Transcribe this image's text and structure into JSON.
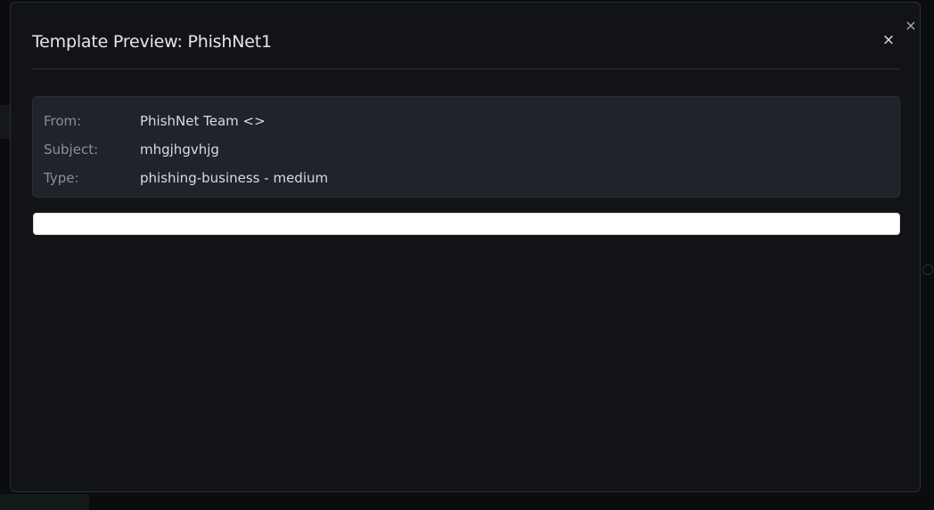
{
  "modal": {
    "title": "Template Preview: PhishNet1",
    "outer_close_glyph": "×",
    "header_close_glyph": "×"
  },
  "meta": {
    "from_label": "From:",
    "from_value": "PhishNet Team <>",
    "subject_label": "Subject:",
    "subject_value": "mhgjhgvhjg",
    "type_label": "Type:",
    "type_value": "phishing-business - medium"
  },
  "colors": {
    "backdrop": "#0b0c0e",
    "modal_bg": "#121317",
    "panel_bg": "#1f232a",
    "label": "#8a8f97",
    "value": "#d8dbdf",
    "preview_bg": "#ffffff"
  }
}
